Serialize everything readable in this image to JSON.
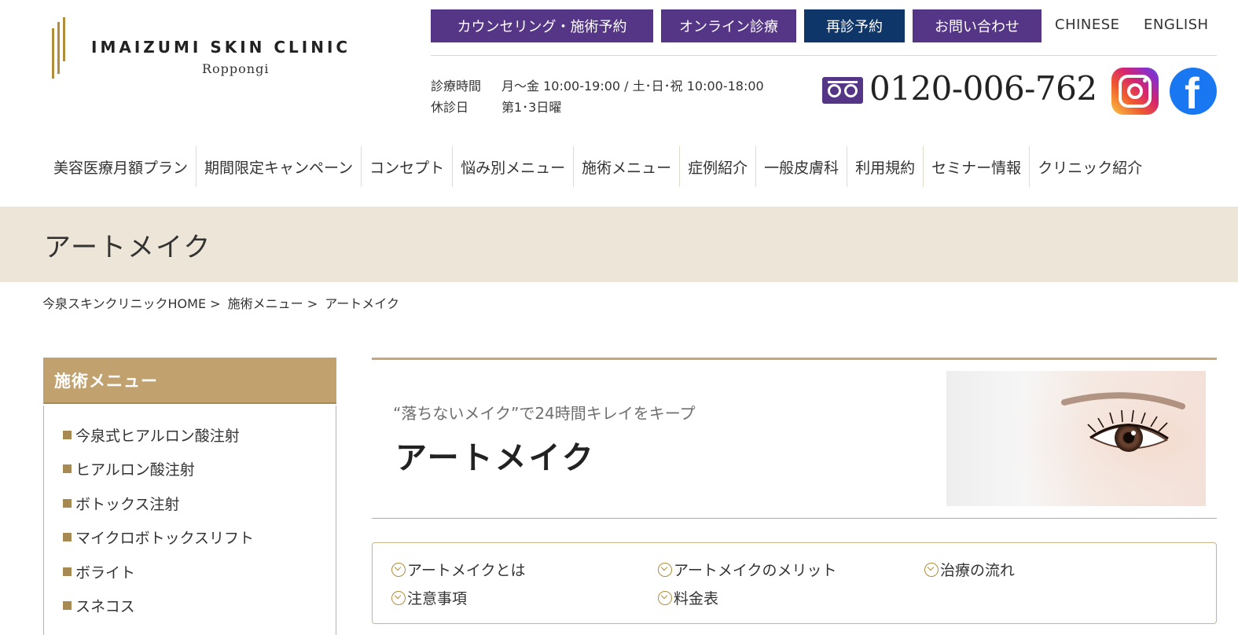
{
  "logo": {
    "title": "IMAIZUMI SKIN CLINIC",
    "subtitle": "Roppongi"
  },
  "header_buttons": [
    {
      "label": "カウンセリング・施術予約",
      "color": "#553585"
    },
    {
      "label": "オンライン診療",
      "color": "#553585"
    },
    {
      "label": "再診予約",
      "color": "#0f3669"
    },
    {
      "label": "お問い合わせ",
      "color": "#553585"
    }
  ],
  "languages": [
    "CHINESE",
    "ENGLISH"
  ],
  "hours": {
    "label": "診療時間",
    "value": "月～金 10:00-19:00 / 土･日･祝 10:00-18:00",
    "closed_label": "休診日",
    "closed_value": "第1･3日曜"
  },
  "phone": {
    "icon": "freedial-icon",
    "number": "0120-006-762"
  },
  "social": [
    "instagram-icon",
    "facebook-icon"
  ],
  "nav": [
    "美容医療月額プラン",
    "期間限定キャンペーン",
    "コンセプト",
    "悩み別メニュー",
    "施術メニュー",
    "症例紹介",
    "一般皮膚科",
    "利用規約",
    "セミナー情報",
    "クリニック紹介"
  ],
  "page_title": "アートメイク",
  "breadcrumb": [
    "今泉スキンクリニックHOME",
    ">",
    "施術メニュー",
    ">",
    "アートメイク"
  ],
  "sidebar": {
    "heading": "施術メニュー",
    "items": [
      "今泉式ヒアルロン酸注射",
      "ヒアルロン酸注射",
      "ボトックス注射",
      "マイクロボトックスリフト",
      "ボライト",
      "スネコス"
    ]
  },
  "hero": {
    "subtitle": "“落ちないメイク”で24時間キレイをキープ",
    "title": "アートメイク"
  },
  "toc": [
    "アートメイクとは",
    "アートメイクのメリット",
    "治療の流れ",
    "注意事項",
    "料金表"
  ],
  "colors": {
    "accent_gold": "#c1a26f",
    "band_beige": "#ede5d7",
    "purple": "#553585",
    "navy": "#0f3669"
  }
}
